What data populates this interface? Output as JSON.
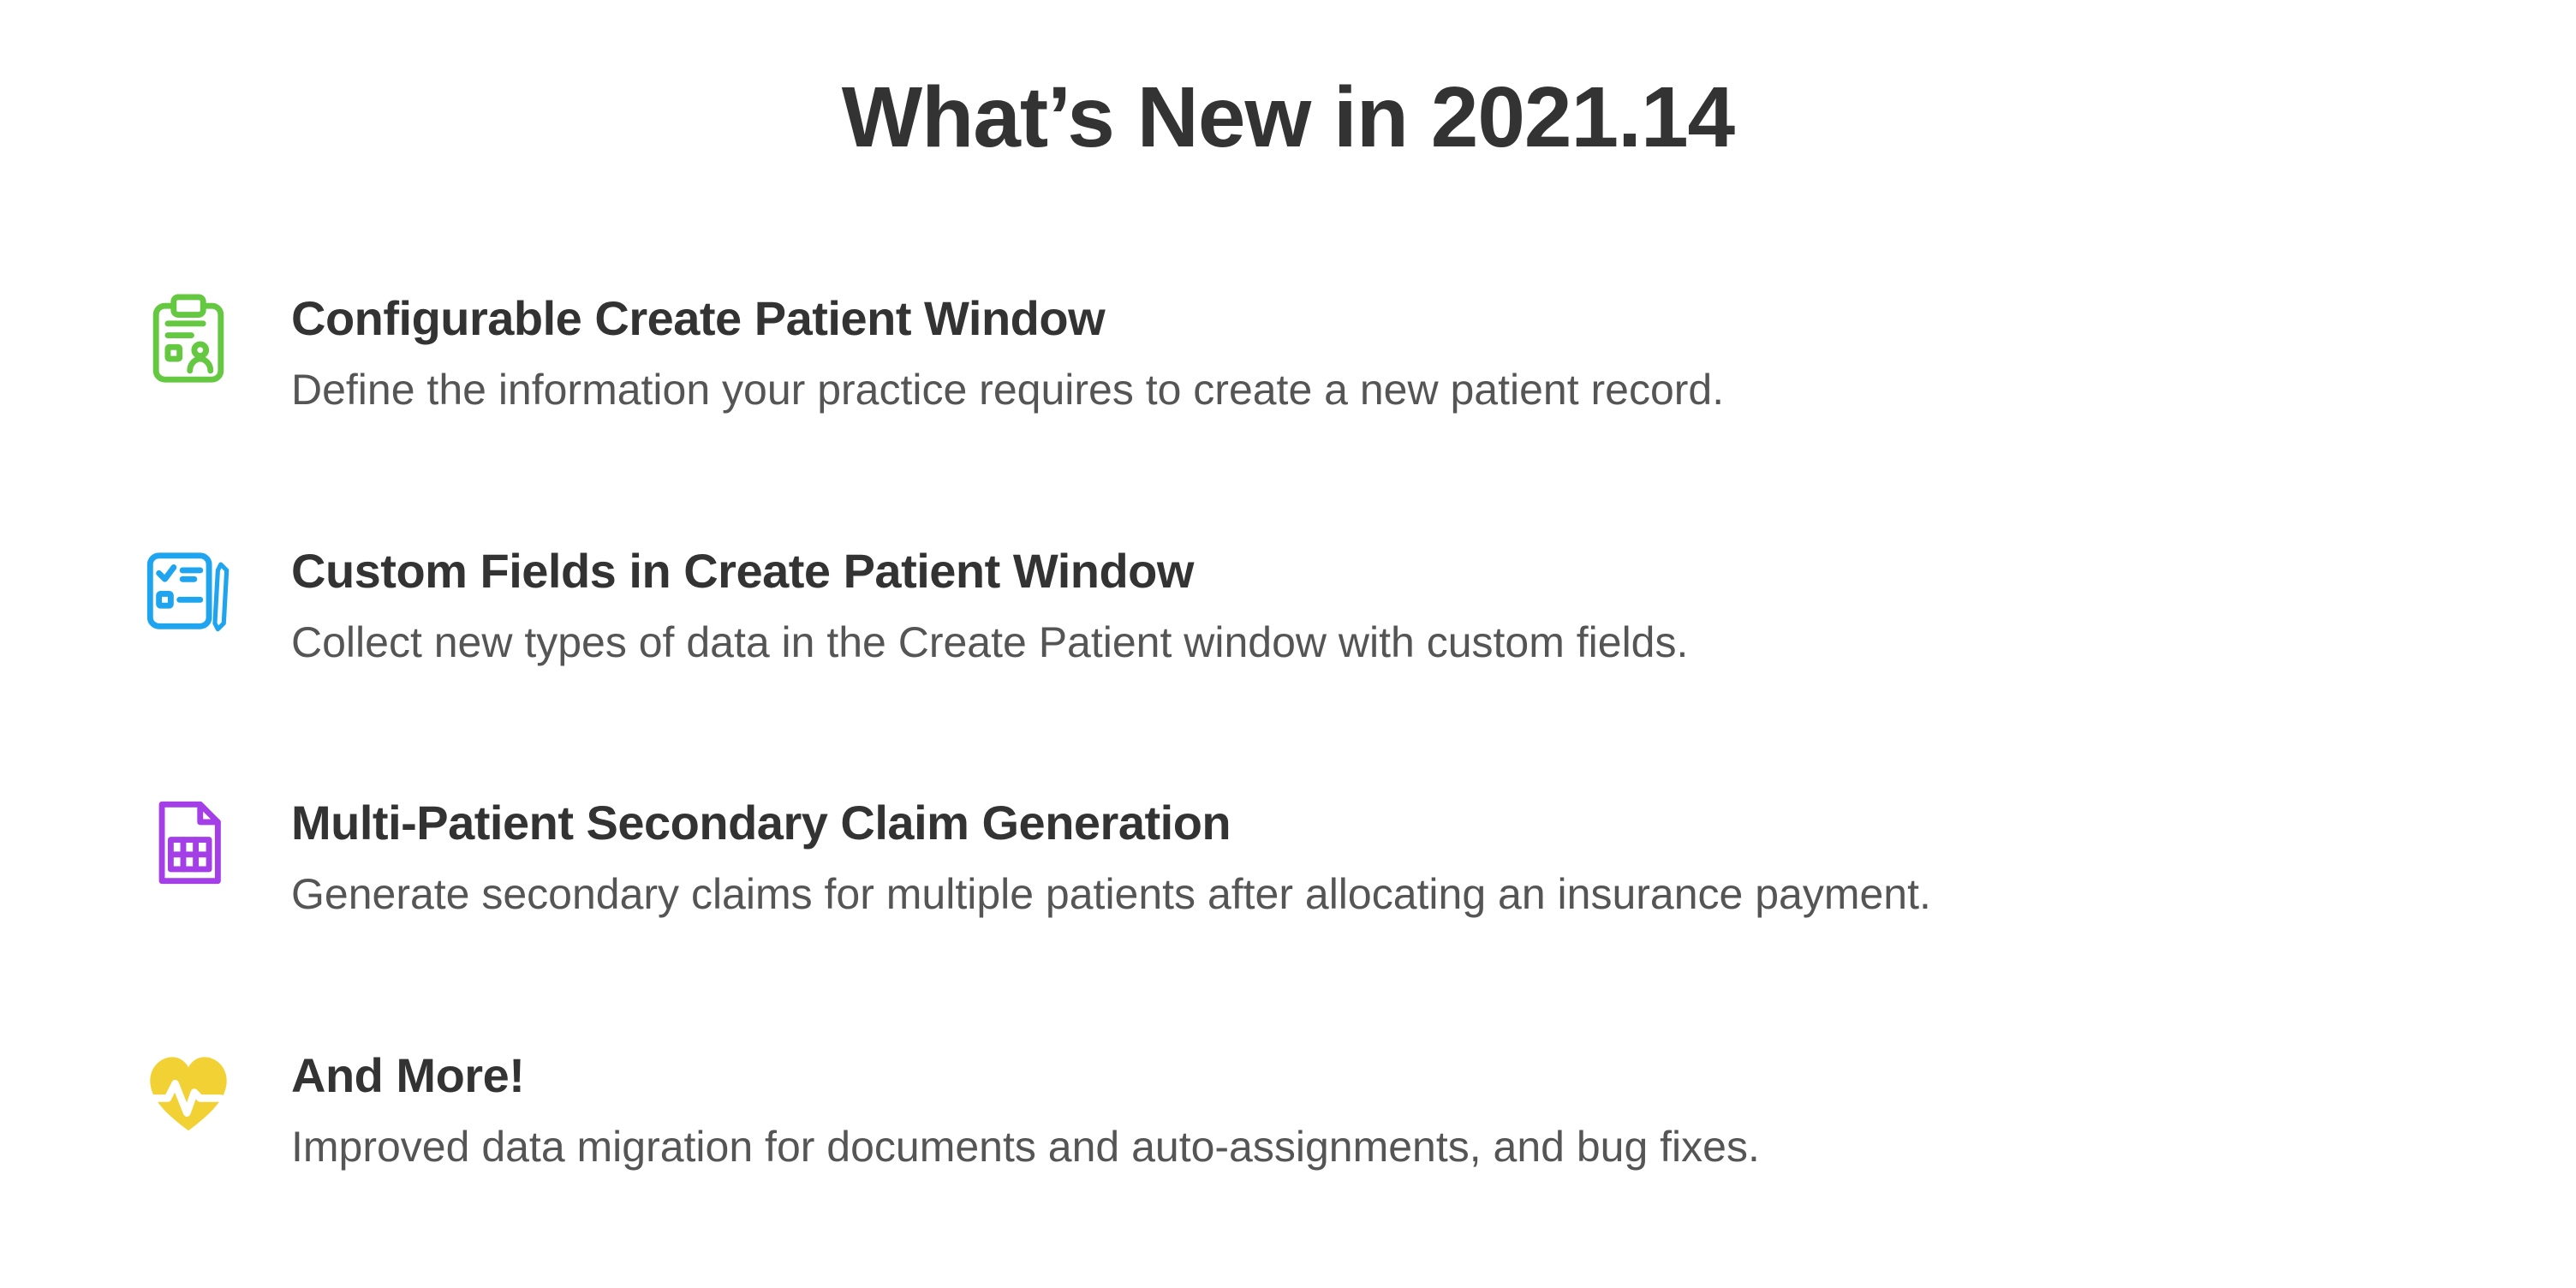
{
  "title": "What’s New in 2021.14",
  "features": [
    {
      "icon": "clipboard-person-icon",
      "color": "#64C840",
      "title": "Configurable Create Patient Window",
      "desc": "Define the information your practice requires to create a new patient record."
    },
    {
      "icon": "checklist-pencil-icon",
      "color": "#1FA5F0",
      "title": "Custom Fields in Create Patient Window",
      "desc": "Collect new types of data in the Create Patient window with custom fields."
    },
    {
      "icon": "spreadsheet-icon",
      "color": "#A43FE8",
      "title": "Multi-Patient Secondary Claim Generation",
      "desc": "Generate secondary claims for multiple patients after allocating an insurance payment."
    },
    {
      "icon": "heart-pulse-icon",
      "color": "#F2D134",
      "title": "And More!",
      "desc": "Improved data migration for documents and auto-assignments, and bug fixes."
    }
  ]
}
